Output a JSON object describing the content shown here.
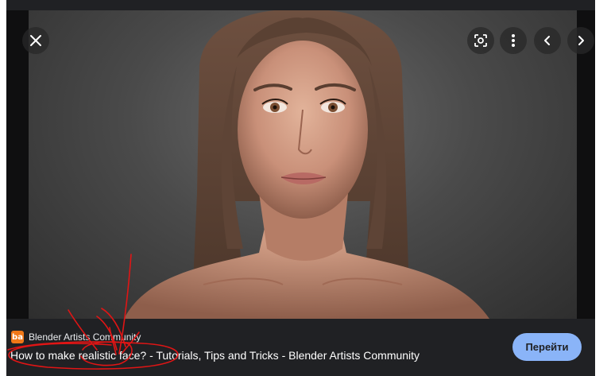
{
  "image": {
    "alt": "3D rendered realistic female face with long brown hair"
  },
  "controls": {
    "close_icon": "close-icon",
    "lens_icon": "google-lens-icon",
    "more_icon": "more-vert-icon",
    "prev_icon": "chevron-left-icon",
    "next_icon": "chevron-right-icon"
  },
  "source": {
    "favicon_text": "ba",
    "favicon_color": "#f07818",
    "name": "Blender Artists Community"
  },
  "title": "How to make realistic face? - Tutorials, Tips and Tricks - Blender Artists Community",
  "visit_button": {
    "label": "Перейти",
    "color": "#8ab4f8"
  },
  "annotation": {
    "color": "#e01515",
    "description": "red hand-drawn scribble circling the word realistic"
  }
}
